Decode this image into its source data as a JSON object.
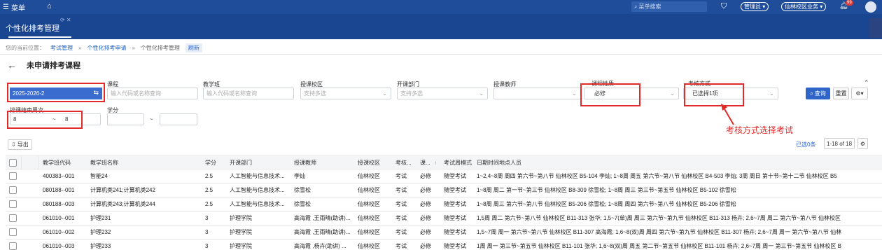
{
  "topbar": {
    "menu_label": "菜单",
    "search_placeholder": "菜单搜索",
    "role": "管理员",
    "campus_business": "仙林校区业务",
    "notif_count": "99"
  },
  "tab": {
    "title": "个性化排考管理"
  },
  "breadcrumb": {
    "prefix": "您的当前位置：",
    "items": [
      "考试管理",
      "个性化排考申请",
      "个性化排考管理"
    ],
    "refresh": "刷新"
  },
  "page_title": "未申请排考课程",
  "filters": {
    "term_value": "2025-2026-2",
    "course_label": "课程",
    "course_placeholder": "输入代码或名称查询",
    "class_label": "教学班",
    "class_placeholder": "输入代码或名称查询",
    "campus_label": "授课校区",
    "campus_placeholder": "支持多选",
    "dept_label": "开课部门",
    "dept_placeholder": "支持多选",
    "teacher_label": "授课教师",
    "nature_label": "课程性质",
    "nature_value": "必修",
    "exam_mode_label": "考核方式",
    "exam_mode_value": "已选择1项",
    "week_label": "排课结束周次",
    "week_from": "8",
    "week_to": "8",
    "credit_label": "学分",
    "range_sep": "~",
    "query_btn": "查询",
    "reset_btn": "重置"
  },
  "annotation": "考核方式选择考试",
  "toolbar": {
    "export": "导出",
    "selected": "已选0条",
    "pager": "1-18 of 18"
  },
  "table": {
    "columns": [
      "教学班代码",
      "教学班名称",
      "学分",
      "开课部门",
      "授课教师",
      "授课校区",
      "考核...",
      "课...",
      "考试周模式",
      "日期时间地点人员"
    ],
    "rows": [
      [
        "400383--001",
        "智能24",
        "2.5",
        "人工智能与信息技术...",
        "李灿",
        "仙林校区",
        "考试",
        "必修",
        "随堂考试",
        "1~2,4~8周 周四 第六节~第八节 仙林校区 B5-104 李灿; 1~8周 周五 第六节~第八节 仙林校区 B4-503 李灿; 3周 周日 第十节~第十二节 仙林校区 B5"
      ],
      [
        "080188--001",
        "计算机类241;计算机类242",
        "2.5",
        "人工智能与信息技术...",
        "徐雪松",
        "仙林校区",
        "考试",
        "必修",
        "随堂考试",
        "1~8周 周二 第一节~第三节 仙林校区 B8-309 徐雪松; 1~8周 周三 第三节~第五节 仙林校区 B5-102 徐雪松"
      ],
      [
        "080188--003",
        "计算机类243;计算机类244",
        "2.5",
        "人工智能与信息技术...",
        "徐雪松",
        "仙林校区",
        "考试",
        "必修",
        "随堂考试",
        "1~8周 周三 第六节~第八节 仙林校区 B5-206 徐雪松; 1~8周 周四 第六节~第八节 仙林校区 B5-206 徐雪松"
      ],
      [
        "061010--001",
        "护理231",
        "3",
        "护理学院",
        "高海霞 ,王雨晴(助讲)...",
        "仙林校区",
        "考试",
        "必修",
        "随堂考试",
        "1,5周 周二 第六节~第八节 仙林校区 B11-313 张华; 1,5~7(单)周 周三 第六节~第九节 仙林校区 B11-313 杨卉; 2,6~7周 周二 第六节~第八节 仙林校区"
      ],
      [
        "061010--002",
        "护理232",
        "3",
        "护理学院",
        "高海霞 ,王雨晴(助讲)...",
        "仙林校区",
        "考试",
        "必修",
        "随堂考试",
        "1,5~7周 周一 第六节~第八节 仙林校区 B11-307 高海霞; 1,6~8(双)周 周四 第六节~第九节 仙林校区 B11-307 杨卉; 2,6~7周 周一 第六节~第八节 仙林"
      ],
      [
        "061010--003",
        "护理233",
        "3",
        "护理学院",
        "高海霞 ,杨卉(助讲) ...",
        "仙林校区",
        "考试",
        "必修",
        "随堂考试",
        "1周 周一 第三节~第五节 仙林校区 B11-101 张华; 1,6~8(双)周 周五 第二节~第五节 仙林校区 B11-101 杨卉; 2,6~7周 周一 第三节~第五节 仙林校区 B"
      ]
    ]
  },
  "colors": {
    "nav": "#1f4d99",
    "accent": "#2f65c9",
    "highlight": "#e12a2a"
  }
}
